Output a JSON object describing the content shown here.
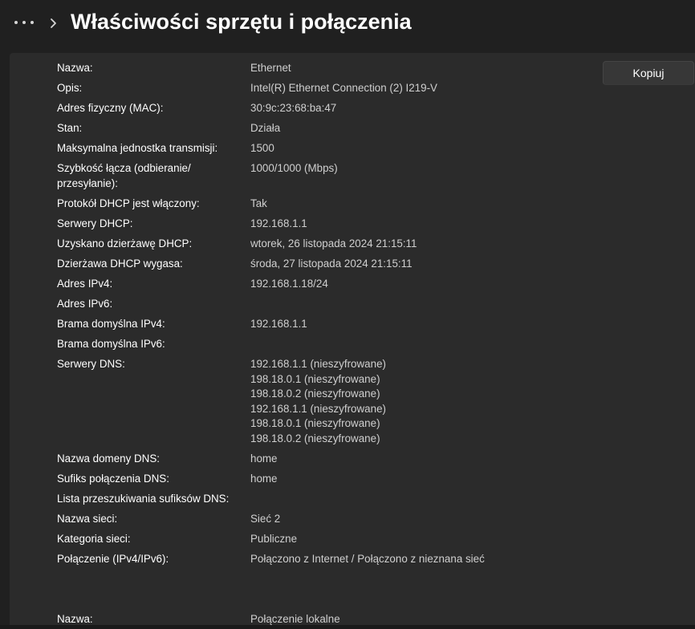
{
  "header": {
    "title": "Właściwości sprzętu i połączenia"
  },
  "toolbar": {
    "copy_label": "Kopiuj"
  },
  "properties": [
    {
      "label": "Nazwa:",
      "value": "Ethernet"
    },
    {
      "label": "Opis:",
      "value": "Intel(R) Ethernet Connection (2) I219-V"
    },
    {
      "label": "Adres fizyczny (MAC):",
      "value": "30:9c:23:68:ba:47"
    },
    {
      "label": "Stan:",
      "value": "Działa"
    },
    {
      "label": "Maksymalna jednostka transmisji:",
      "value": "1500"
    },
    {
      "label": "Szybkość łącza (odbieranie/ przesyłanie):",
      "value": "1000/1000 (Mbps)"
    },
    {
      "label": "Protokół DHCP jest włączony:",
      "value": "Tak"
    },
    {
      "label": "Serwery DHCP:",
      "value": "192.168.1.1"
    },
    {
      "label": "Uzyskano dzierżawę DHCP:",
      "value": "wtorek, 26 listopada 2024 21:15:11"
    },
    {
      "label": "Dzierżawa DHCP wygasa:",
      "value": "środa, 27 listopada 2024 21:15:11"
    },
    {
      "label": "Adres IPv4:",
      "value": "192.168.1.18/24"
    },
    {
      "label": "Adres IPv6:",
      "value": ""
    },
    {
      "label": "Brama domyślna IPv4:",
      "value": "192.168.1.1"
    },
    {
      "label": "Brama domyślna IPv6:",
      "value": ""
    },
    {
      "label": "Serwery DNS:",
      "values": [
        "192.168.1.1 (nieszyfrowane)",
        "198.18.0.1 (nieszyfrowane)",
        "198.18.0.2 (nieszyfrowane)",
        "192.168.1.1 (nieszyfrowane)",
        "198.18.0.1 (nieszyfrowane)",
        "198.18.0.2 (nieszyfrowane)"
      ]
    },
    {
      "label": "Nazwa domeny DNS:",
      "value": "home"
    },
    {
      "label": "Sufiks połączenia DNS:",
      "value": "home"
    },
    {
      "label": "Lista przeszukiwania sufiksów DNS:",
      "value": ""
    },
    {
      "label": "Nazwa sieci:",
      "value": "Sieć 2"
    },
    {
      "label": "Kategoria sieci:",
      "value": "Publiczne"
    },
    {
      "label": "Połączenie (IPv4/IPv6):",
      "value": "Połączono z Internet / Połączono z nieznana sieć"
    }
  ],
  "second_adapter": {
    "label": "Nazwa:",
    "value": "Połączenie lokalne"
  }
}
